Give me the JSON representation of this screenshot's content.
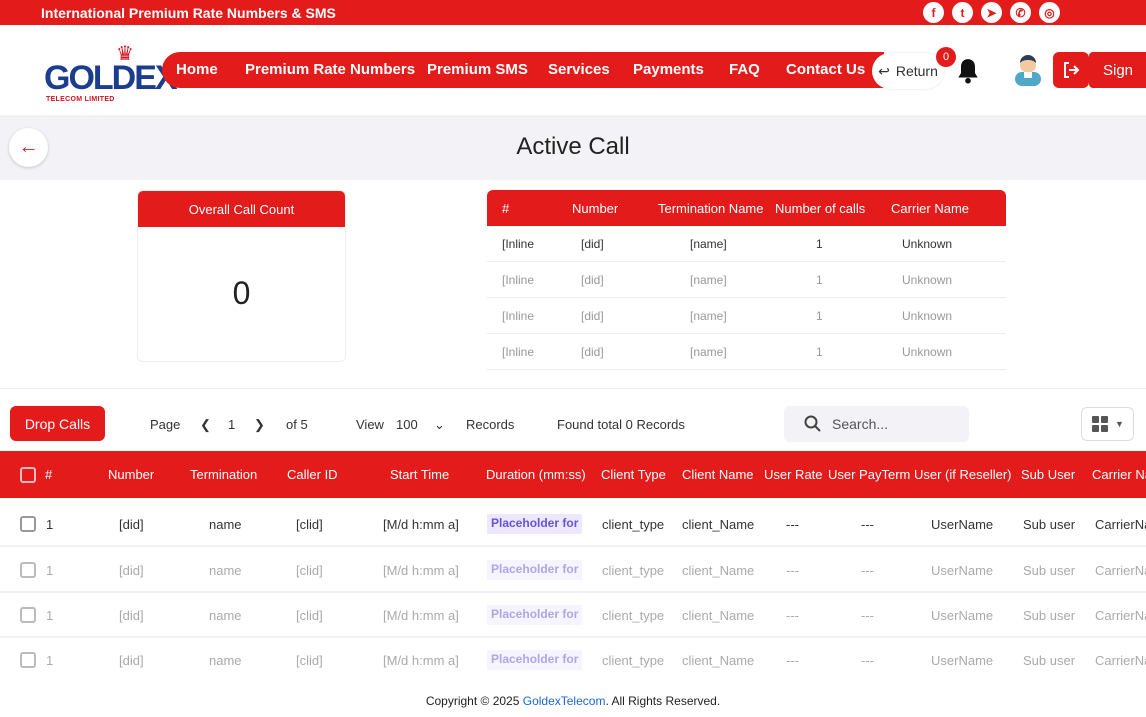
{
  "topbar": {
    "title": "International Premium Rate Numbers & SMS",
    "social": [
      "f",
      "t",
      "➤",
      "✆",
      "◎"
    ]
  },
  "logo": {
    "name": "GOLDEX",
    "sub": "TELECOM LIMITED"
  },
  "nav": [
    "Home",
    "Premium Rate Numbers",
    "Premium SMS",
    "Services",
    "Payments",
    "FAQ",
    "Contact Us"
  ],
  "header": {
    "return_label": "Return",
    "notification_count": "0",
    "signin_label": "Sign"
  },
  "page": {
    "title": "Active Call"
  },
  "count_card": {
    "title": "Overall Call Count",
    "value": "0"
  },
  "mini_table": {
    "headers": [
      "#",
      "Number",
      "Termination Name",
      "Number of calls",
      "Carrier Name"
    ],
    "rows": [
      [
        "[Inline",
        "[did]",
        "[name]",
        "1",
        "Unknown"
      ],
      [
        "[Inline",
        "[did]",
        "[name]",
        "1",
        "Unknown"
      ],
      [
        "[Inline",
        "[did]",
        "[name]",
        "1",
        "Unknown"
      ],
      [
        "[Inline",
        "[did]",
        "[name]",
        "1",
        "Unknown"
      ]
    ]
  },
  "toolbar": {
    "drop_label": "Drop Calls",
    "page_label": "Page",
    "page_value": "1",
    "of_label": "of 5",
    "view_label": "View",
    "view_value": "100",
    "records_label": "Records",
    "found_label": "Found total 0 Records",
    "search_placeholder": "Search..."
  },
  "grid": {
    "headers": [
      "#",
      "Number",
      "Termination",
      "Caller ID",
      "Start Time",
      "Duration (mm:ss)",
      "Client Type",
      "Client Name",
      "User Rate",
      "User PayTerm",
      "User (if Reseller)",
      "Sub User",
      "Carrier Na"
    ],
    "rows": [
      [
        "1",
        "[did]",
        "name",
        "[clid]",
        "[M/d h:mm a]",
        "Placeholder for",
        "client_type",
        "client_Name",
        "---",
        "---",
        "UserName",
        "Sub user",
        "CarrierNa"
      ],
      [
        "1",
        "[did]",
        "name",
        "[clid]",
        "[M/d h:mm a]",
        "Placeholder for",
        "client_type",
        "client_Name",
        "---",
        "---",
        "UserName",
        "Sub user",
        "CarrierNa"
      ],
      [
        "1",
        "[did]",
        "name",
        "[clid]",
        "[M/d h:mm a]",
        "Placeholder for",
        "client_type",
        "client_Name",
        "---",
        "---",
        "UserName",
        "Sub user",
        "CarrierNa"
      ],
      [
        "1",
        "[did]",
        "name",
        "[clid]",
        "[M/d h:mm a]",
        "Placeholder for",
        "client_type",
        "client_Name",
        "---",
        "---",
        "UserName",
        "Sub user",
        "CarrierNa"
      ]
    ]
  },
  "footer": {
    "prefix": "Copyright © 2025 ",
    "brand": "GoldexTelecom",
    "suffix": ". All Rights Reserved."
  },
  "colors": {
    "accent": "#e31b1b",
    "brand_blue": "#1c3d8f"
  }
}
